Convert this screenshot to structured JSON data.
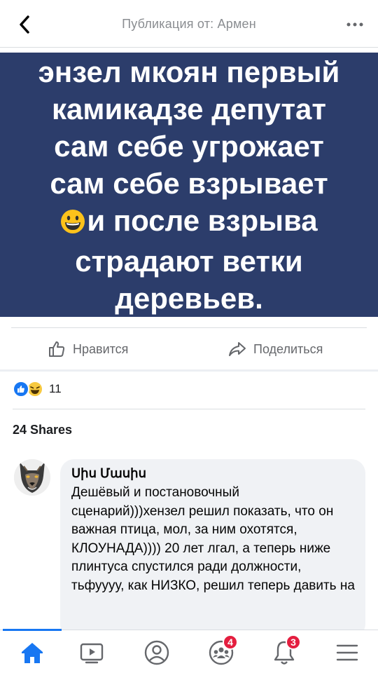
{
  "header": {
    "title": "Публикация от: Армен",
    "back_icon": "chevron-left-icon",
    "more_icon": "more-dots-icon"
  },
  "post": {
    "lines_before_emoji": [
      "энзел мкоян первый",
      "камикадзе депутат",
      "сам себе угрожает",
      "сам себе взрывает"
    ],
    "emoji_line_text": "и после взрыва",
    "lines_after_emoji": [
      "страдают ветки",
      "деревьев."
    ],
    "emoji": "grinning-face-icon",
    "background_color": "#2c3d6b"
  },
  "actions": {
    "like_label": "Нравится",
    "share_label": "Поделиться"
  },
  "reactions": {
    "count": "11",
    "types": [
      "like-reaction-icon",
      "haha-reaction-icon"
    ]
  },
  "shares": {
    "label": "24 Shares"
  },
  "comment": {
    "author": "Սիս Մասիս",
    "text": "Дешёвый и постановочный сценарий)))хензел  решил показать, что он важная птица, мол, за ним охотятся, КЛОУНАДА)))) 20 лет лгал, а теперь ниже плинтуса спустился ради должности, тьфуууу, как НИЗКО, решил теперь давить на"
  },
  "nav": {
    "items": [
      {
        "name": "home",
        "icon": "home-icon",
        "active": true
      },
      {
        "name": "watch",
        "icon": "video-icon",
        "active": false
      },
      {
        "name": "profile",
        "icon": "profile-icon",
        "active": false
      },
      {
        "name": "groups",
        "icon": "groups-icon",
        "badge": "4"
      },
      {
        "name": "notifications",
        "icon": "bell-icon",
        "badge": "3"
      },
      {
        "name": "menu",
        "icon": "menu-icon",
        "active": false
      }
    ],
    "accent_color": "#1877f2",
    "badge_color": "#e41e3f"
  }
}
